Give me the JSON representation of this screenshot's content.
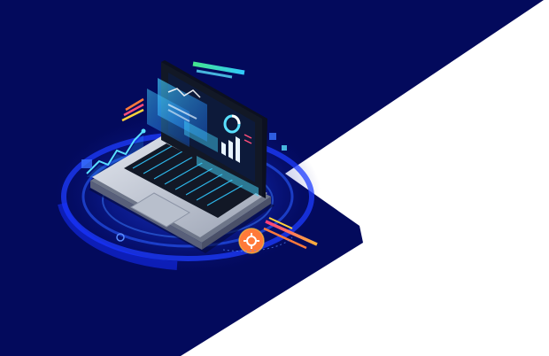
{
  "illustration": {
    "subject": "isometric-laptop-analytics",
    "icons": [
      "laptop-icon",
      "bar-chart-icon",
      "line-chart-icon",
      "donut-chart-icon",
      "gear-icon"
    ],
    "colors": {
      "background": "#ffffff",
      "navy": "#030a5c",
      "glow_blue": "#1f3fff",
      "screen_cyan": "#30c8ff",
      "laptop_silver": "#c9ced8",
      "laptop_dark": "#121826",
      "accent_orange": "#ff7a3a",
      "accent_pink": "#ff3d7a",
      "accent_yellow": "#ffd23a",
      "accent_green": "#44e68c"
    }
  }
}
